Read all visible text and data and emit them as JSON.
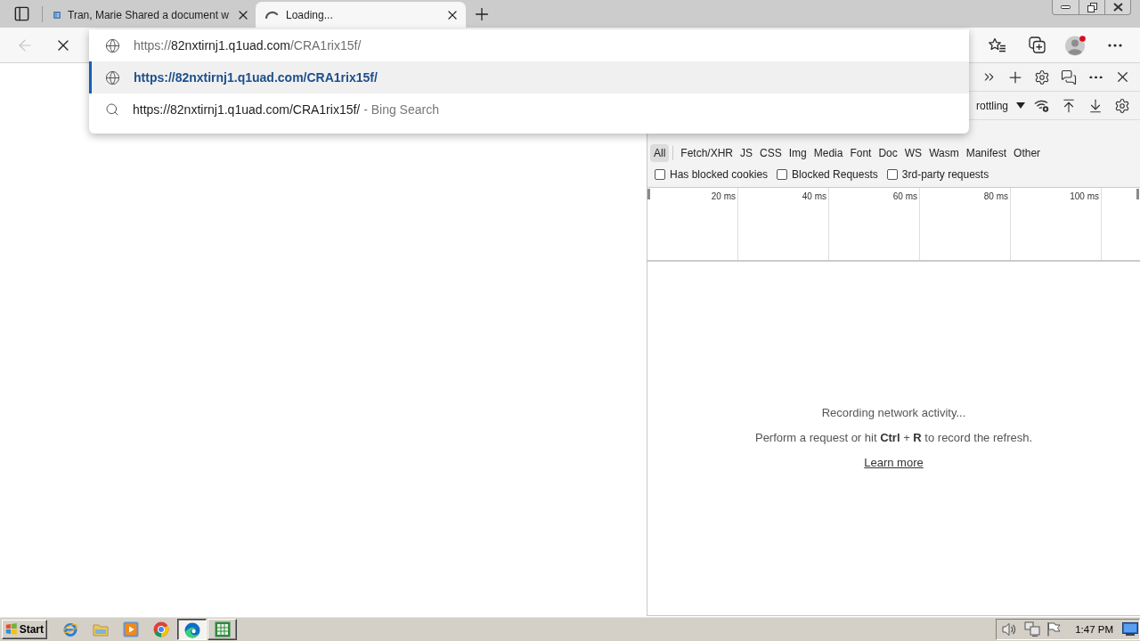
{
  "tab_strip": {
    "tabs": [
      {
        "kind": "document",
        "title": "Tran, Marie Shared a document w",
        "selected": false
      },
      {
        "kind": "loading",
        "title": "Loading...",
        "selected": true
      }
    ]
  },
  "toolbar": {
    "back_disabled": true
  },
  "omnibox": {
    "address": [
      {
        "kind": "scheme",
        "text": "https://"
      },
      {
        "kind": "host",
        "text": "82nxtirnj1.q1uad.com"
      },
      {
        "kind": "path",
        "text": "/CRA1rix15f/"
      }
    ],
    "suggestions": [
      {
        "kind": "url",
        "text": "https://82nxtirnj1.q1uad.com/CRA1rix15f/",
        "selected": true
      },
      {
        "kind": "search",
        "text": "https://82nxtirnj1.q1uad.com/CRA1rix15f/",
        "suffix": "- Bing Search",
        "selected": false
      }
    ]
  },
  "devtools": {
    "throttling": "rottling",
    "type_filters": [
      {
        "label": "All",
        "selected": true
      },
      {
        "label": "Fetch/XHR",
        "selected": false
      },
      {
        "label": "JS",
        "selected": false
      },
      {
        "label": "CSS",
        "selected": false
      },
      {
        "label": "Img",
        "selected": false
      },
      {
        "label": "Media",
        "selected": false
      },
      {
        "label": "Font",
        "selected": false
      },
      {
        "label": "Doc",
        "selected": false
      },
      {
        "label": "WS",
        "selected": false
      },
      {
        "label": "Wasm",
        "selected": false
      },
      {
        "label": "Manifest",
        "selected": false
      },
      {
        "label": "Other",
        "selected": false
      }
    ],
    "checkboxes": [
      {
        "label": "Has blocked cookies",
        "checked": false
      },
      {
        "label": "Blocked Requests",
        "checked": false
      },
      {
        "label": "3rd-party requests",
        "checked": false
      }
    ],
    "overview_ticks": [
      "20 ms",
      "40 ms",
      "60 ms",
      "80 ms",
      "100 ms"
    ],
    "empty_state": {
      "title": "Recording network activity...",
      "hint": "Perform a request or hit **Ctrl** + **R** to record the refresh.",
      "link": "Learn more"
    }
  },
  "taskbar": {
    "start": "Start",
    "apps": [
      {
        "kind": "ie",
        "open": false,
        "selected": false
      },
      {
        "kind": "folder",
        "open": false,
        "selected": false
      },
      {
        "kind": "media",
        "open": false,
        "selected": false
      },
      {
        "kind": "chrome",
        "open": false,
        "selected": false
      },
      {
        "kind": "edge",
        "open": true,
        "selected": true
      },
      {
        "kind": "excel",
        "open": true,
        "selected": false
      }
    ],
    "clock": "1:47 PM"
  }
}
